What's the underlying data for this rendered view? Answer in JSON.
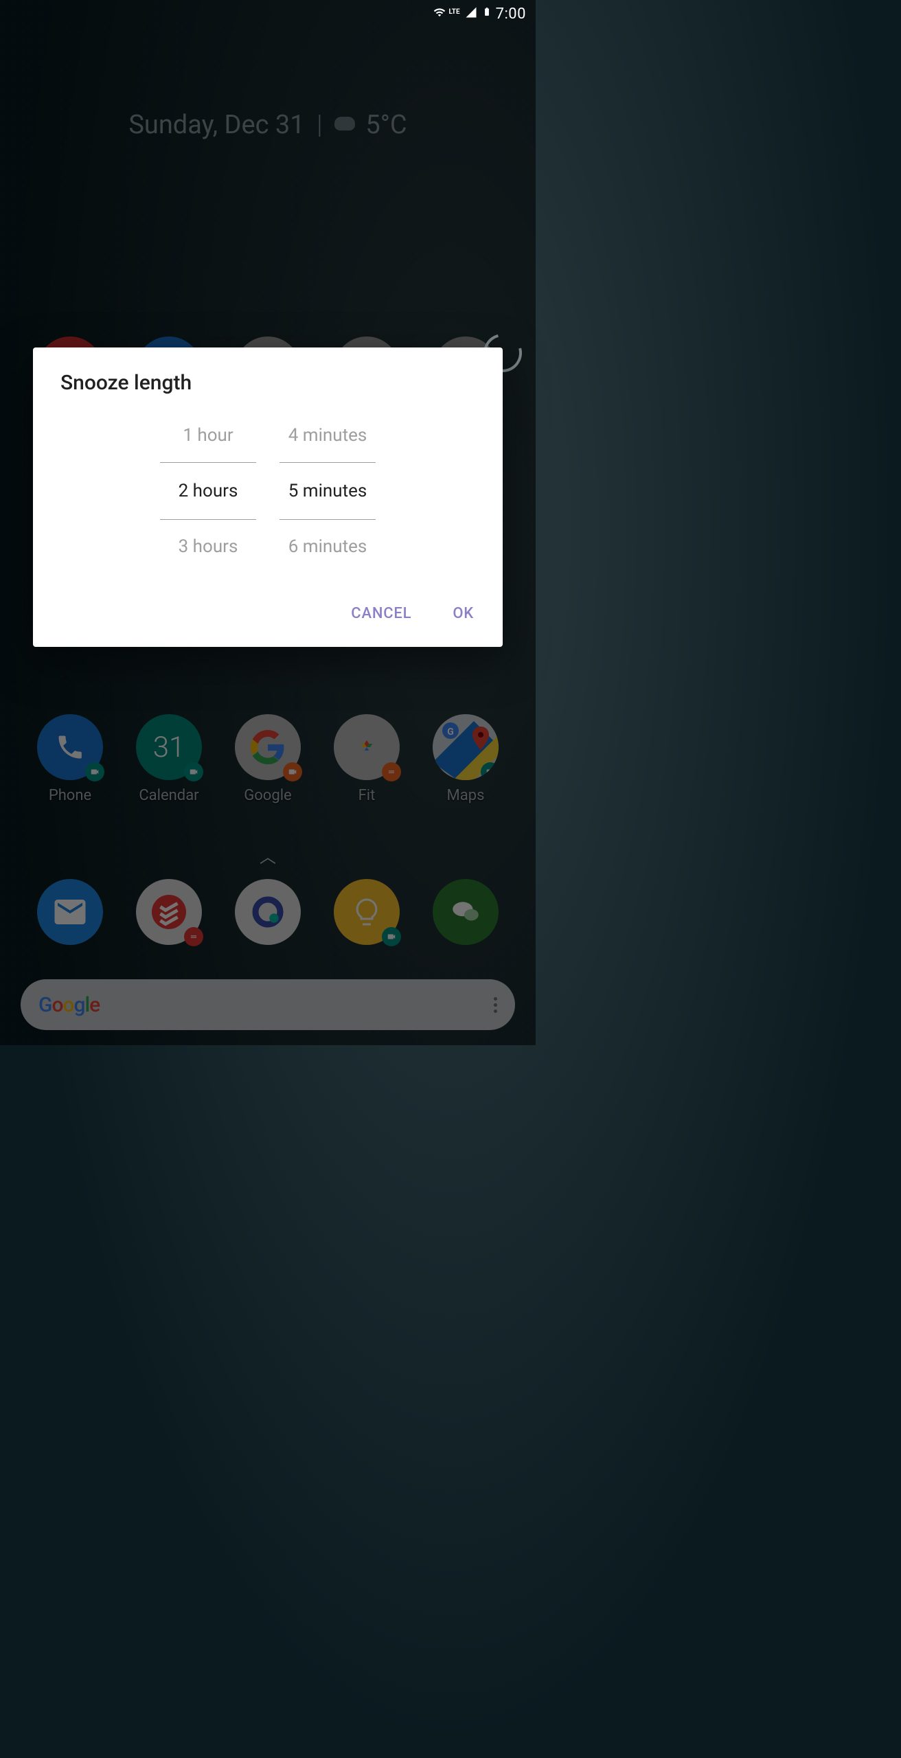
{
  "status": {
    "time": "7:00",
    "network_label": "LTE"
  },
  "widget": {
    "date": "Sunday, Dec 31",
    "temp": "5°C"
  },
  "dialog": {
    "title": "Snooze length",
    "hours": {
      "prev": "1 hour",
      "selected": "2 hours",
      "next": "3 hours"
    },
    "minutes": {
      "prev": "4 minutes",
      "selected": "5 minutes",
      "next": "6 minutes"
    },
    "cancel": "CANCEL",
    "ok": "OK"
  },
  "apps_mid": [
    {
      "label": "Phone"
    },
    {
      "label": "Calendar",
      "day": "31"
    },
    {
      "label": "Google"
    },
    {
      "label": "Fit"
    },
    {
      "label": "Maps"
    }
  ],
  "search": {
    "brand": "Google"
  }
}
